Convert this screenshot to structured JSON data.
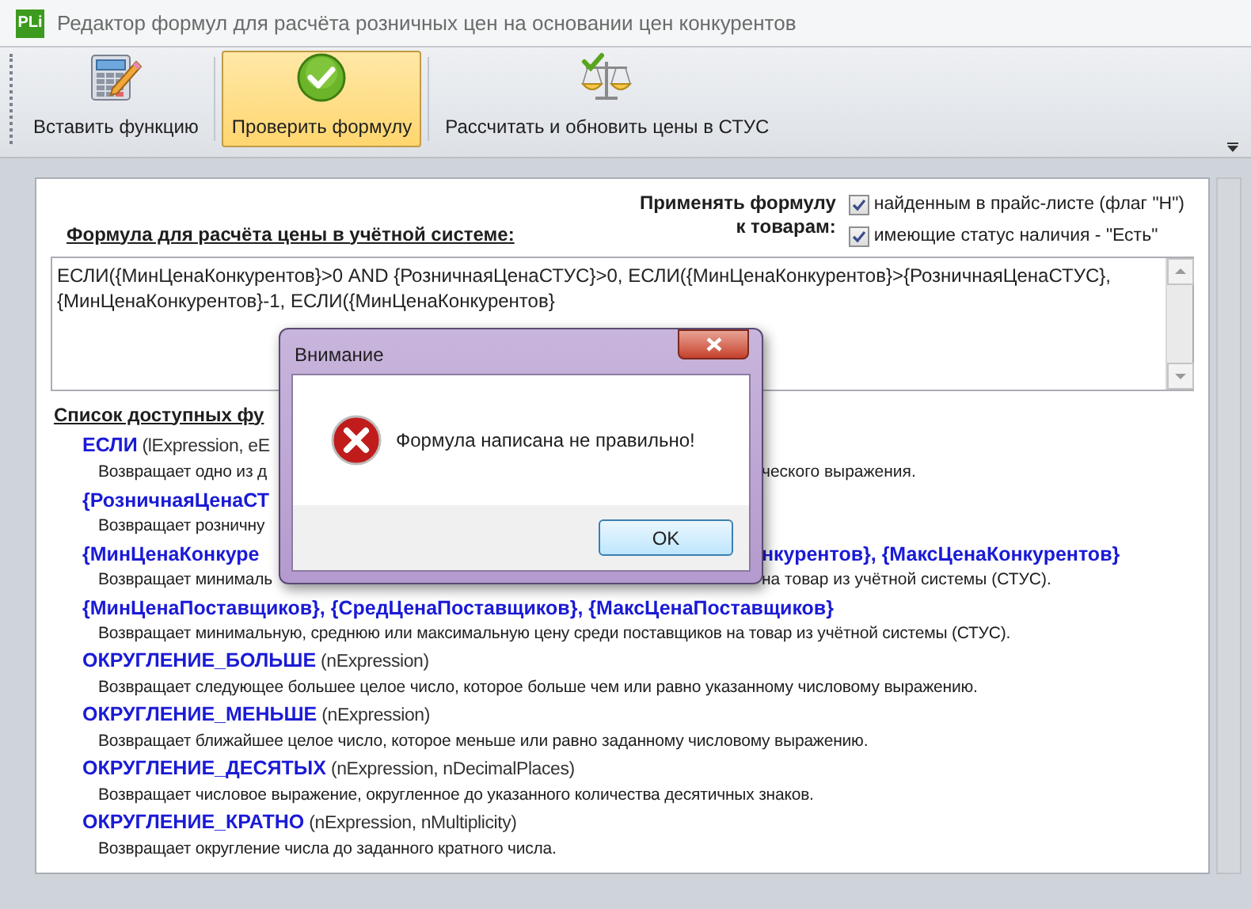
{
  "window": {
    "title": "Редактор формул для расчёта розничных цен на основании цен конкурентов",
    "app_icon": "PLi"
  },
  "toolbar": [
    {
      "kind": "calculator",
      "label": "Вставить функцию",
      "selected": false
    },
    {
      "kind": "check",
      "label": "Проверить формулу",
      "selected": true
    },
    {
      "kind": "scales",
      "label": "Рассчитать и обновить цены в СТУС",
      "selected": false
    }
  ],
  "apply_label": "Применять формулу к товарам:",
  "apply_options": [
    {
      "label": "найденным в прайс-листе (флаг \"Н\")",
      "checked": true
    },
    {
      "label": "имеющие статус наличия - \"Есть\"",
      "checked": true
    }
  ],
  "formula_label": "Формула для расчёта цены в учётной системе:",
  "formula": "ЕСЛИ({МинЦенаКонкурентов}>0 AND {РозничнаяЦенаСТУС}>0, ЕСЛИ({МинЦенаКонкурентов}>{РозничнаяЦенаСТУС}, {МинЦенаКонкурентов}-1, ЕСЛИ({МинЦенаКонкурентов}",
  "functions_label": "Список доступных фу",
  "functions": [
    {
      "name": "ЕСЛИ",
      "params": " (lExpression, eE",
      "description": "Возвращает одно из д",
      "description_right": "ческого выражения."
    },
    {
      "name": "{РозничнаяЦенаСТ",
      "description": "Возвращает розничну"
    },
    {
      "name": "{МинЦенаКонкуре",
      "name_right": "нкурентов}, {МаксЦенаКонкурентов}",
      "description": "Возвращает минималь",
      "description_right": "на товар из учётной системы (СТУС)."
    },
    {
      "name": "{МинЦенаПоставщиков}, {СредЦенаПоставщиков}, {МаксЦенаПоставщиков}",
      "description": "Возвращает минимальную, среднюю или максимальную цену среди поставщиков на товар из учётной системы (СТУС)."
    },
    {
      "name": "ОКРУГЛЕНИЕ_БОЛЬШЕ",
      "params": " (nExpression)",
      "description": "Возвращает следующее большее целое число, которое больше чем или равно указанному числовому выражению."
    },
    {
      "name": "ОКРУГЛЕНИЕ_МЕНЬШЕ",
      "params": " (nExpression)",
      "description": "Возвращает ближайшее целое число, которое меньше или равно заданному числовому выражению."
    },
    {
      "name": "ОКРУГЛЕНИЕ_ДЕСЯТЫХ",
      "params": " (nExpression, nDecimalPlaces)",
      "description": "Возвращает числовое выражение, округленное до указанного количества десятичных знаков."
    },
    {
      "name": "ОКРУГЛЕНИЕ_КРАТНО",
      "params": " (nExpression, nMultiplicity)",
      "description": "Возвращает округление числа до заданного кратного числа."
    }
  ],
  "dialog": {
    "title": "Внимание",
    "message": "Формула написана не правильно!",
    "button": "OK"
  }
}
